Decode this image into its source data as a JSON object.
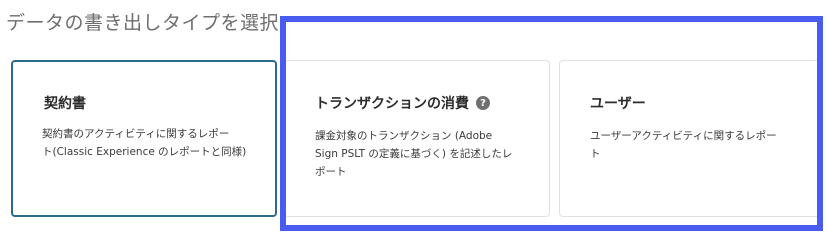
{
  "heading": "データの書き出しタイプを選択：",
  "cards": [
    {
      "title": "契約書",
      "desc_lines": [
        "契約書のアクティビティに関するレポー",
        "ト(Classic Experience のレポートと同様)"
      ],
      "selected": true
    },
    {
      "title": "トランザクションの消費",
      "help_icon": "?",
      "desc_lines": [
        "課金対象のトランザクション (Adobe",
        "Sign PSLT の定義に基づく) を記述したレ",
        "ポート"
      ],
      "selected": false
    },
    {
      "title": "ユーザー",
      "desc_lines": [
        "ユーザーアクティビティに関するレポー",
        "ト"
      ],
      "selected": false
    }
  ],
  "colors": {
    "selected_border": "#2c6b8f",
    "card_border": "#e1e1e1",
    "highlight": "#4a5cf0",
    "heading_text": "#6e6e6e"
  }
}
